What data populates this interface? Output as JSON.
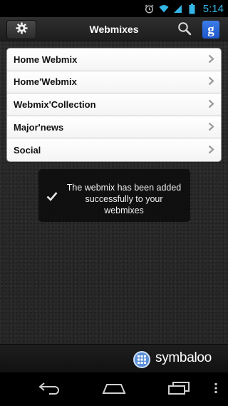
{
  "status_bar": {
    "time": "5:14",
    "icons": [
      "alarm-icon",
      "wifi-icon",
      "signal-icon",
      "battery-icon"
    ],
    "accent_color": "#33b5e5"
  },
  "header": {
    "title": "Webmixes",
    "settings_icon": "gear-icon",
    "search_icon": "search-icon",
    "google_label": "g"
  },
  "webmix_list": {
    "items": [
      {
        "label": "Home Webmix"
      },
      {
        "label": "Home'Webmix"
      },
      {
        "label": "Webmix'Collection"
      },
      {
        "label": "Major'news"
      },
      {
        "label": "Social"
      }
    ],
    "chevron_icon": "chevron-right-icon"
  },
  "toast": {
    "message": "The webmix has been added successfully to your webmixes",
    "icon": "checkmark-icon"
  },
  "footer": {
    "brand_name": "symbaloo",
    "brand_icon": "symbaloo-logo-icon"
  },
  "nav_bar": {
    "buttons": [
      "back-icon",
      "home-icon",
      "recent-apps-icon",
      "menu-icon"
    ]
  }
}
